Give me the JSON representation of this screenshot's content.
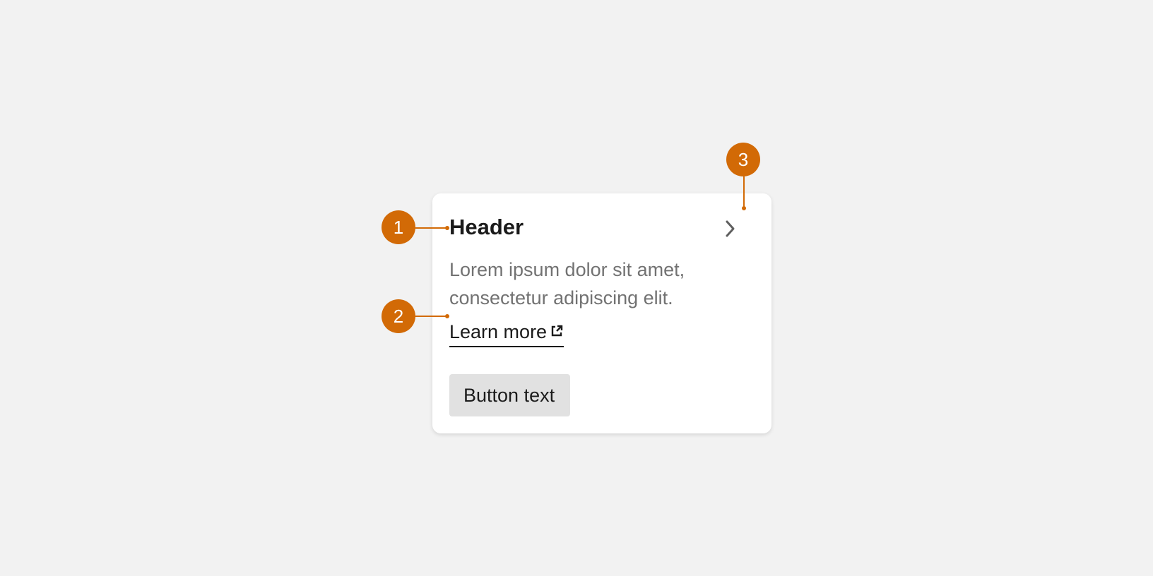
{
  "card": {
    "header": "Header",
    "body_text": "Lorem ipsum dolor sit amet, consectetur adipiscing elit.",
    "link_label": "Learn more",
    "button_label": "Button text",
    "chevron_icon": "chevron-right-icon",
    "link_icon": "external-link-icon"
  },
  "annotations": [
    {
      "label": "1"
    },
    {
      "label": "2"
    },
    {
      "label": "3"
    }
  ],
  "colors": {
    "background": "#f2f2f2",
    "card": "#ffffff",
    "accent": "#d26a06",
    "header_text": "#1b1b1b",
    "body_text": "#727272",
    "button_bg": "#e1e1e1"
  }
}
